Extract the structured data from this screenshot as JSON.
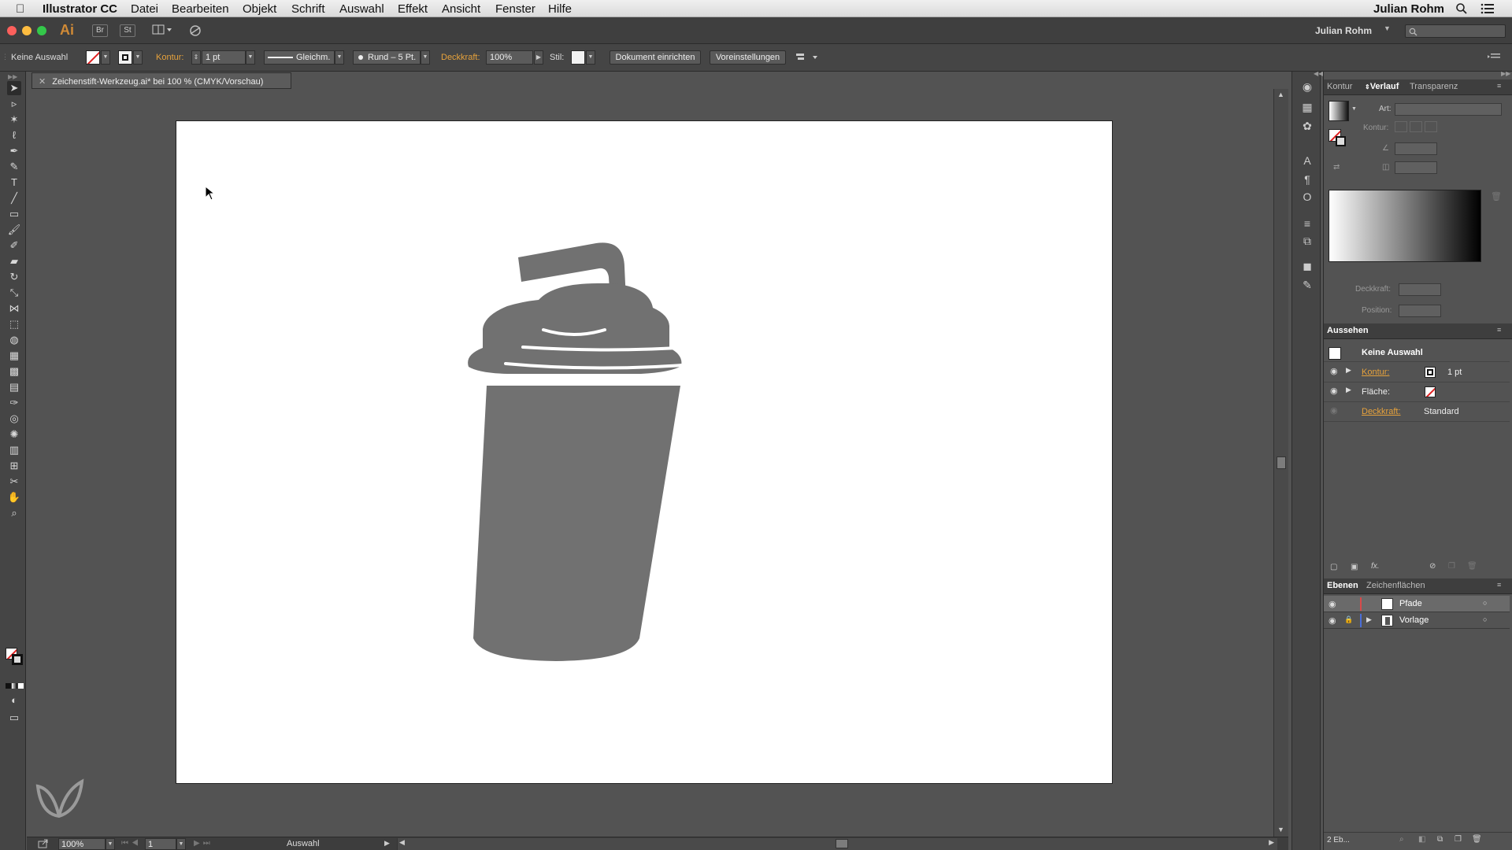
{
  "menubar": {
    "apple": "",
    "app_name": "Illustrator CC",
    "items": [
      "Datei",
      "Bearbeiten",
      "Objekt",
      "Schrift",
      "Auswahl",
      "Effekt",
      "Ansicht",
      "Fenster",
      "Hilfe"
    ],
    "user": "Julian Rohm"
  },
  "apptoolbar": {
    "logo": "Ai",
    "bridge": "Br",
    "stock": "St",
    "workspace_user": "Julian Rohm",
    "traffic_colors": [
      "#fc605c",
      "#fdbc40",
      "#34c84a"
    ]
  },
  "control": {
    "selection": "Keine Auswahl",
    "kontur_label": "Kontur:",
    "kontur_value": "1 pt",
    "stroke_profile": "Gleichm.",
    "brush": "Rund – 5 Pt.",
    "deckkraft_label": "Deckkraft:",
    "deckkraft_value": "100%",
    "stil_label": "Stil:",
    "dokument_button": "Dokument einrichten",
    "voreinstellungen_button": "Voreinstellungen"
  },
  "document": {
    "tab_title": "Zeichenstift-Werkzeug.ai* bei 100 % (CMYK/Vorschau)",
    "artwork_color": "#717171"
  },
  "tools": [
    "selection-tool",
    "direct-selection-tool",
    "magic-wand-tool",
    "lasso-tool",
    "pen-tool",
    "curvature-tool",
    "type-tool",
    "line-tool",
    "rectangle-tool",
    "paintbrush-tool",
    "shaper-tool",
    "eraser-tool",
    "rotate-tool",
    "scale-tool",
    "width-tool",
    "free-transform-tool",
    "shape-builder-tool",
    "perspective-grid-tool",
    "mesh-tool",
    "gradient-tool",
    "eyedropper-tool",
    "blend-tool",
    "symbol-sprayer-tool",
    "column-graph-tool",
    "artboard-tool",
    "slice-tool",
    "hand-tool",
    "zoom-tool"
  ],
  "statusbar": {
    "zoom": "100%",
    "page": "1",
    "mode": "Auswahl"
  },
  "panel_gradient": {
    "tabs": [
      "Kontur",
      "Verlauf",
      "Transparenz"
    ],
    "art_label": "Art:",
    "kontur_label": "Kontur:",
    "deckkraft_label": "Deckkraft:",
    "position_label": "Position:"
  },
  "panel_appearance": {
    "title": "Aussehen",
    "selection": "Keine Auswahl",
    "rows": [
      {
        "label": "Kontur:",
        "value": "1 pt"
      },
      {
        "label": "Fläche:",
        "value": ""
      },
      {
        "label": "Deckkraft:",
        "value": "Standard"
      }
    ]
  },
  "panel_layers": {
    "tabs": [
      "Ebenen",
      "Zeichenflächen"
    ],
    "layers": [
      {
        "name": "Pfade",
        "color": "#d84a4a"
      },
      {
        "name": "Vorlage",
        "color": "#4a6ed8"
      }
    ],
    "count": "2 Eb..."
  }
}
